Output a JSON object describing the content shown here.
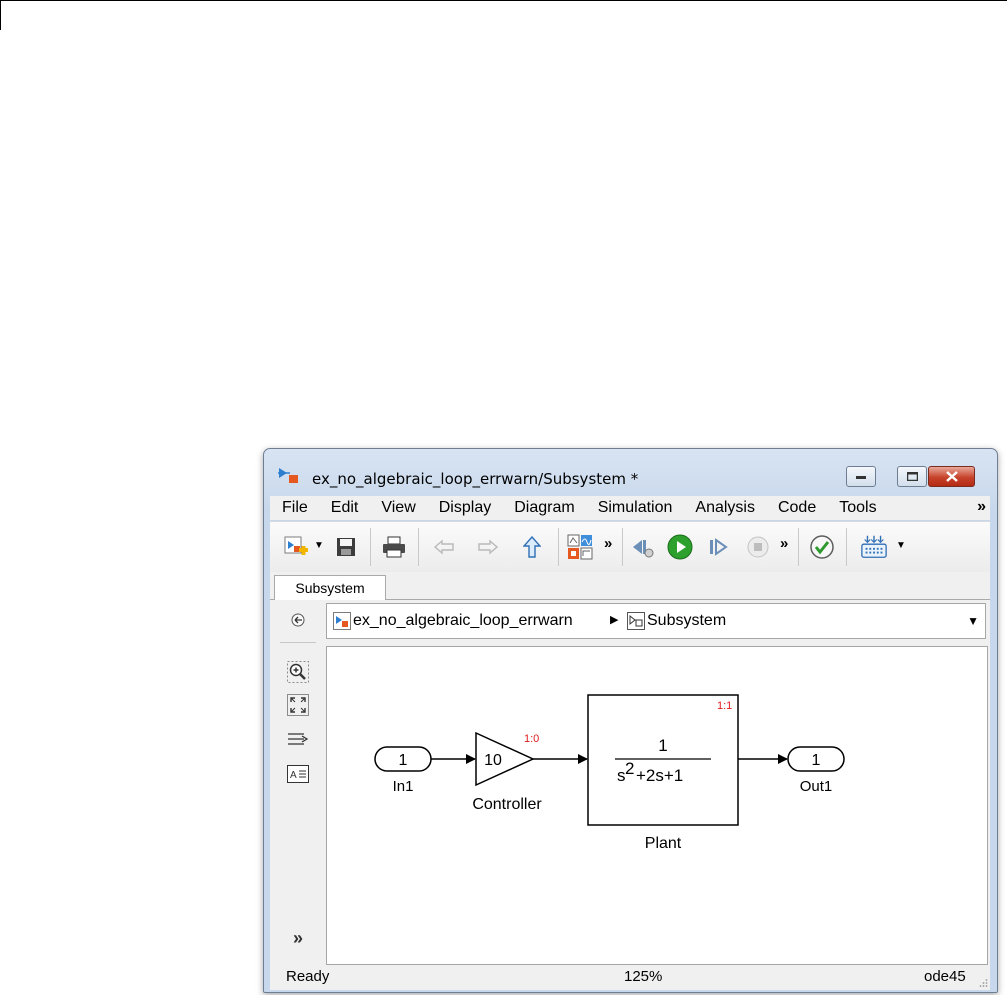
{
  "window": {
    "title": "ex_no_algebraic_loop_errwarn/Subsystem *"
  },
  "menu": {
    "items": [
      "File",
      "Edit",
      "View",
      "Display",
      "Diagram",
      "Simulation",
      "Analysis",
      "Code",
      "Tools"
    ],
    "more": "»"
  },
  "toolbar": {
    "more_glyph": "»",
    "dropdown_glyph": "▼"
  },
  "tabs": [
    {
      "label": "Subsystem",
      "active": true
    }
  ],
  "breadcrumb": {
    "model": "ex_no_algebraic_loop_errwarn",
    "separator": "▶",
    "current": "Subsystem",
    "dropdown": "▼"
  },
  "palette": {
    "expand": "»"
  },
  "diagram": {
    "inport": {
      "number": "1",
      "label": "In1"
    },
    "gain": {
      "value": "10",
      "label": "Controller",
      "annotation": "1:0"
    },
    "transfer_fcn": {
      "numerator": "1",
      "denominator_s": "s",
      "denominator_exp": "2",
      "denominator_rest": "+2s+1",
      "label": "Plant",
      "annotation": "1:1"
    },
    "outport": {
      "number": "1",
      "label": "Out1"
    },
    "annotation_color": "#e0191b"
  },
  "status": {
    "state": "Ready",
    "zoom": "125%",
    "solver": "ode45"
  }
}
